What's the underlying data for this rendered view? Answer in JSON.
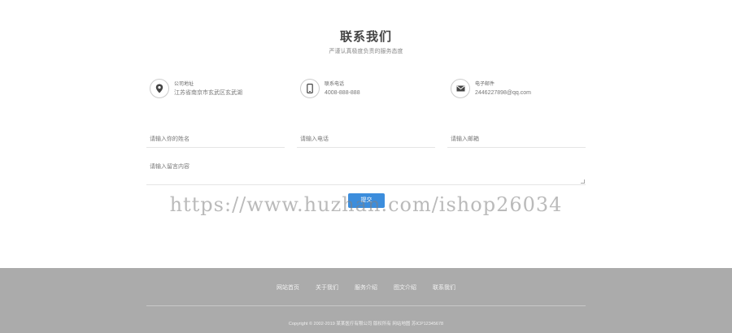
{
  "section": {
    "title": "联系我们",
    "subtitle": "严谨认真极度负责的服务态度"
  },
  "contact_info": [
    {
      "icon": "location-icon",
      "label": "公司地址",
      "value": "江苏省南京市玄武区玄武湖"
    },
    {
      "icon": "phone-icon",
      "label": "联系电话",
      "value": "4008-888-888"
    },
    {
      "icon": "mail-icon",
      "label": "电子邮件",
      "value": "2446227898@qq.com"
    }
  ],
  "form": {
    "name_placeholder": "请输入你的姓名",
    "phone_placeholder": "请输入电话",
    "email_placeholder": "请输入邮箱",
    "message_placeholder": "请输入留言内容",
    "submit_label": "提交"
  },
  "watermark": "https://www.huzhan.com/ishop26034",
  "footer": {
    "nav": [
      "网站首页",
      "关于我们",
      "服务介绍",
      "图文介绍",
      "联系我们"
    ],
    "copyright": "Copyright © 2002-2019 某某医疗有限公司 版权所有  网站地图  苏ICP12345678"
  },
  "colors": {
    "accent": "#3c8ddc",
    "footer_bg": "#ababab"
  }
}
